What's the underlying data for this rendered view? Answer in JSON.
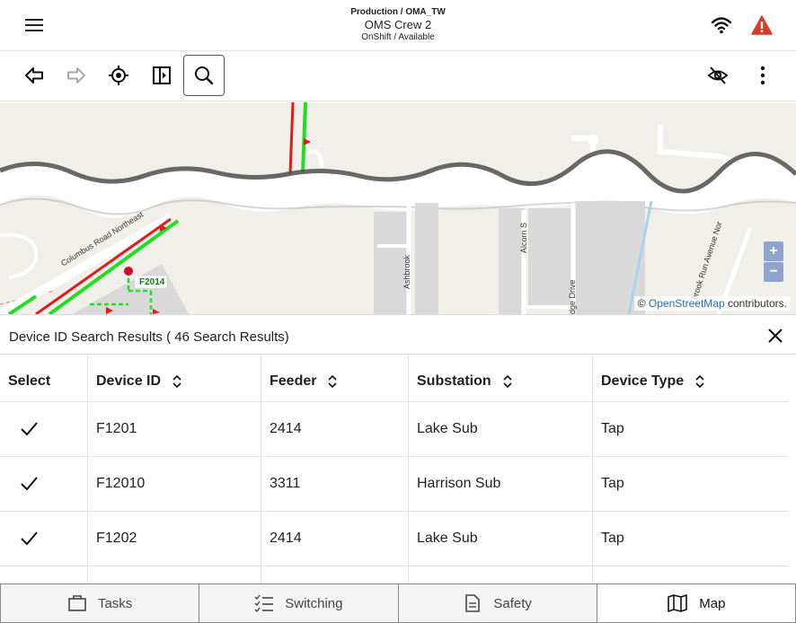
{
  "header": {
    "environment": "Production / OMA_TW",
    "title": "OMS Crew 2",
    "status": "OnShift / Available"
  },
  "map": {
    "labels": {
      "road1": "Columbus Road Northeast",
      "feeder": "F2014",
      "street1": "Ashbrook",
      "street2": "Alcorn S",
      "street3": "dge Drive",
      "street4": "brook Run Avenue Nor"
    },
    "attribution_prefix": "©",
    "attribution_link": "OpenStreetMap",
    "attribution_suffix": "contributors.",
    "zoom_in": "+",
    "zoom_out": "−"
  },
  "results": {
    "title": "Device ID Search Results ( 46 Search Results)",
    "columns": [
      "Select",
      "Device ID",
      "Feeder",
      "Substation",
      "Device Type"
    ],
    "rows": [
      {
        "device_id": "F1201",
        "feeder": "2414",
        "substation": "Lake Sub",
        "device_type": "Tap"
      },
      {
        "device_id": "F12010",
        "feeder": "3311",
        "substation": "Harrison Sub",
        "device_type": "Tap"
      },
      {
        "device_id": "F1202",
        "feeder": "2414",
        "substation": "Lake Sub",
        "device_type": "Tap"
      }
    ]
  },
  "tabs": [
    {
      "label": "Tasks",
      "icon": "briefcase-icon"
    },
    {
      "label": "Switching",
      "icon": "checklist-icon"
    },
    {
      "label": "Safety",
      "icon": "document-icon"
    },
    {
      "label": "Map",
      "icon": "map-icon"
    }
  ],
  "colors": {
    "accent": "#2a6db5",
    "warning": "#d93a2b",
    "line_red": "#e31a1c",
    "line_green": "#22dd22"
  }
}
